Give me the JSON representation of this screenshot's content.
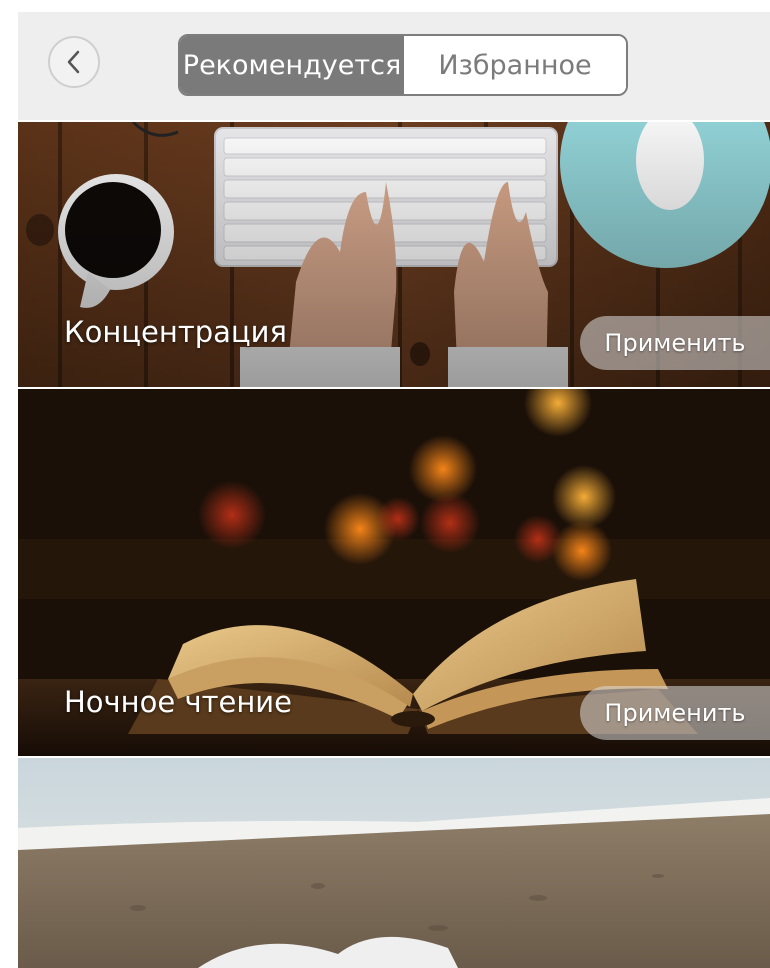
{
  "header": {
    "tabs": [
      {
        "label": "Рекомендуется",
        "active": true
      },
      {
        "label": "Избранное",
        "active": false
      }
    ]
  },
  "cards": [
    {
      "title": "Концентрация",
      "button": "Применить"
    },
    {
      "title": "Ночное чтение",
      "button": "Применить"
    }
  ],
  "colors": {
    "tab_active_bg": "#7a7a7a",
    "header_bg": "#eeeeee"
  }
}
